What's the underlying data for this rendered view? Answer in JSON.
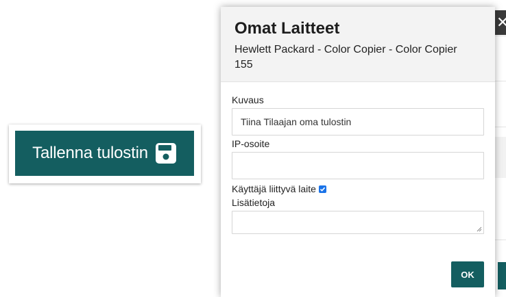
{
  "snippet": {
    "save_button_label": "Tallenna tulostin",
    "save_icon": "floppy-disk-icon"
  },
  "modal": {
    "title": "Omat Laitteet",
    "subtitle": "Hewlett Packard - Color Copier - Color Copier 155",
    "close_icon": "close-icon",
    "fields": {
      "description_label": "Kuvaus",
      "description_value": "Tiina Tilaajan oma tulostin",
      "ip_label": "IP-osoite",
      "ip_value": "",
      "user_device_label": "Käyttäjä liittyvä laite",
      "user_device_checked": true,
      "extra_info_label": "Lisätietoja",
      "extra_info_value": ""
    },
    "ok_label": "OK"
  },
  "colors": {
    "primary": "#145e60",
    "checkbox": "#1a73e8",
    "header_bg": "#f3f3f3"
  }
}
